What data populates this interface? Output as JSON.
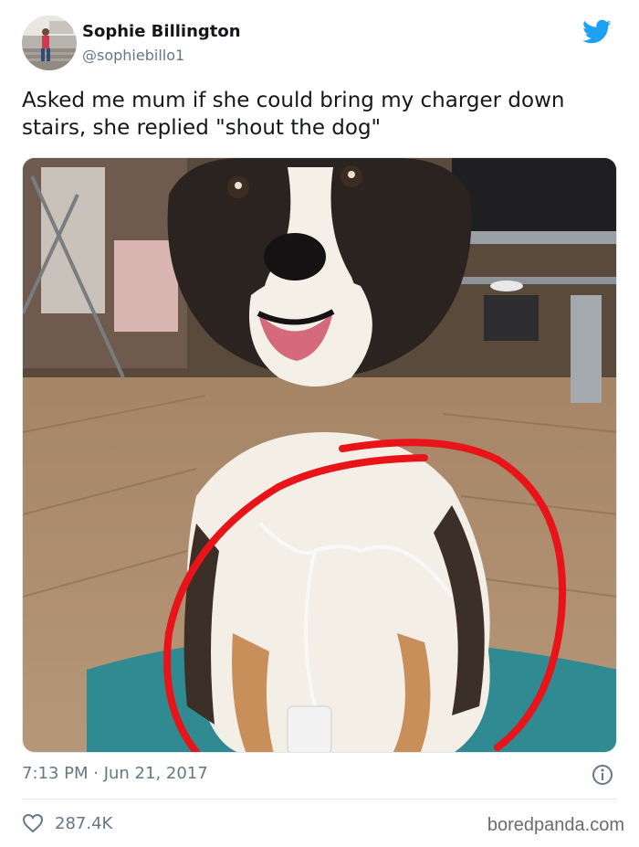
{
  "tweet": {
    "author_name": "Sophie Billington",
    "author_handle": "@sophiebillo1",
    "text": "Asked me mum if she could bring my charger down stairs, she replied \"shout the dog\"",
    "timestamp": "7:13 PM · Jun 21, 2017",
    "likes": "287.4K"
  },
  "icons": {
    "brand": "twitter-bird-icon",
    "info": "info-icon",
    "like": "heart-icon"
  },
  "watermark": "boredpanda.com",
  "colors": {
    "twitter_blue": "#1da1f2",
    "annotation_red": "#e8141a",
    "muted_text": "#657786"
  }
}
